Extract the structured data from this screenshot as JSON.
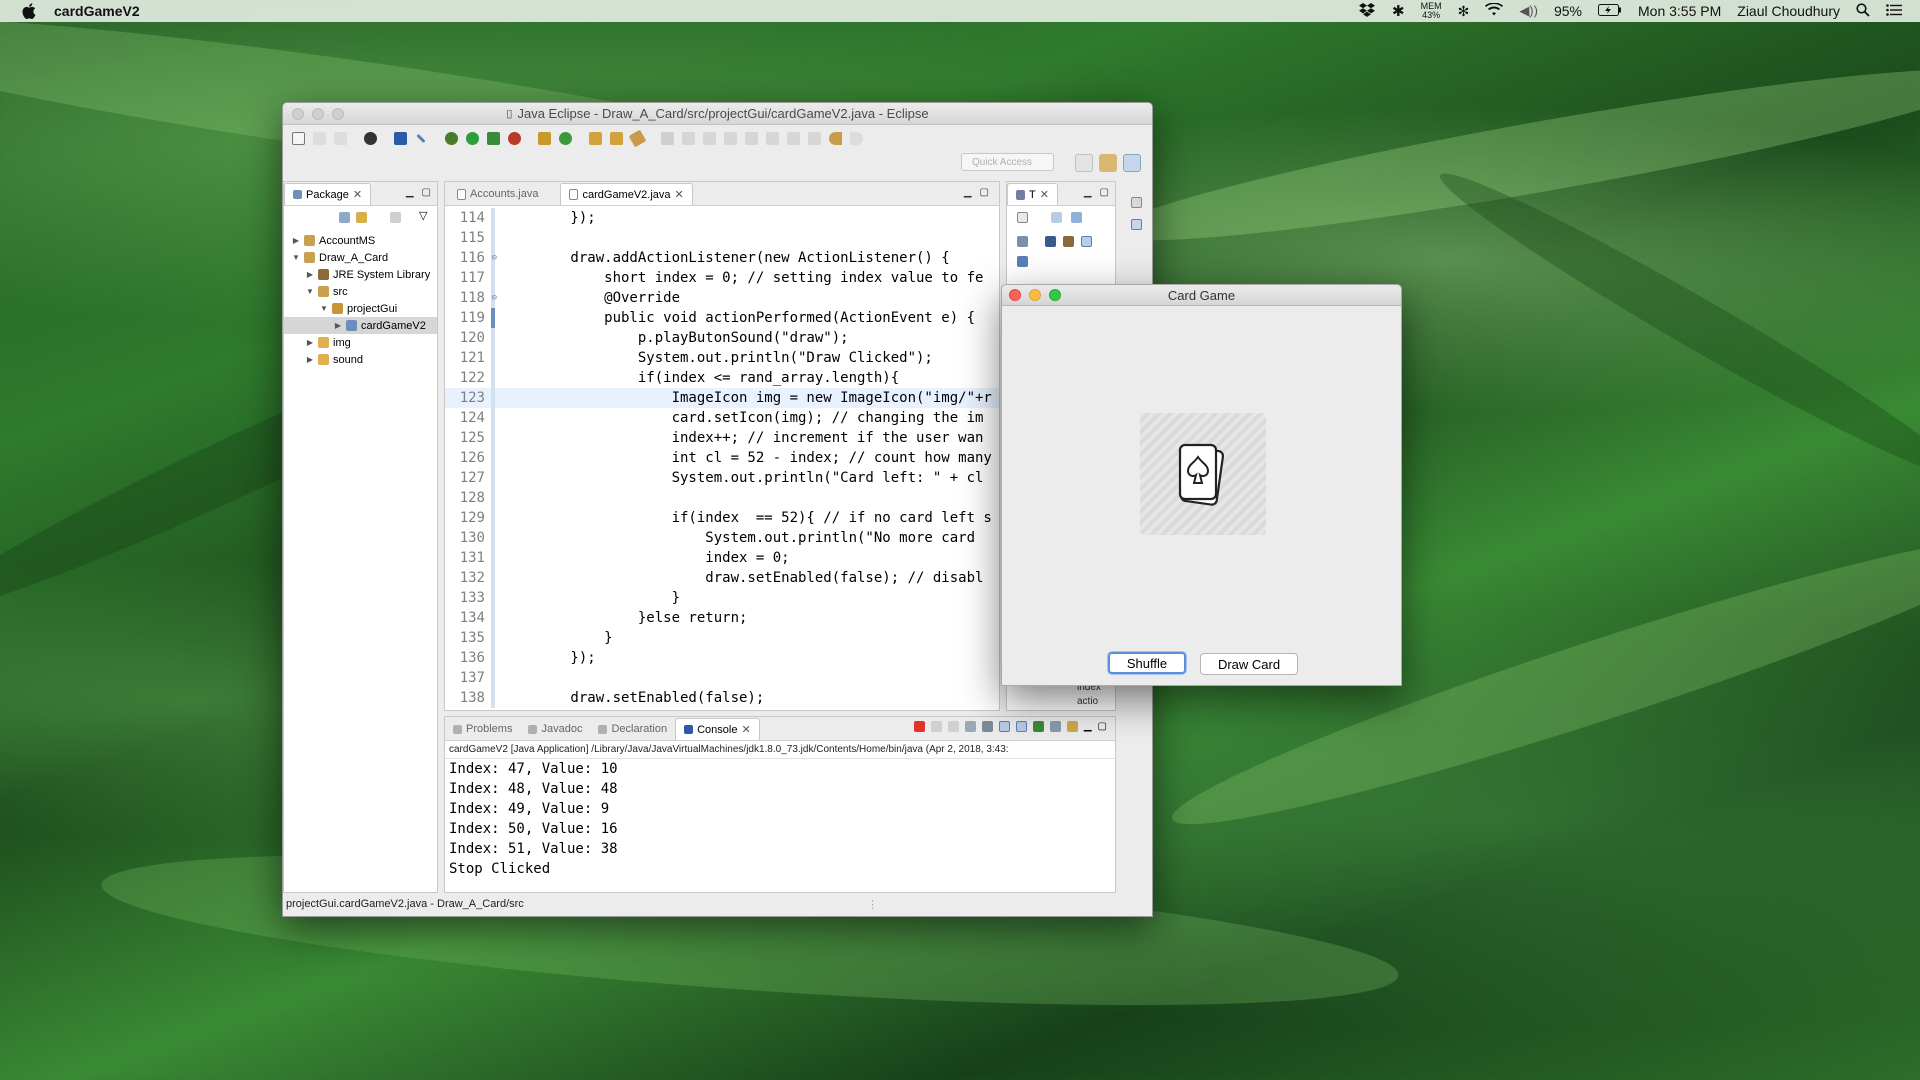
{
  "menubar": {
    "app_name": "cardGameV2",
    "mem_label": "MEM",
    "mem_value": "43%",
    "battery": "95%",
    "clock": "Mon 3:55 PM",
    "user": "Ziaul Choudhury"
  },
  "eclipse": {
    "title": "Java Eclipse - Draw_A_Card/src/projectGui/cardGameV2.java - Eclipse",
    "quick_access_placeholder": "Quick Access",
    "package_explorer": {
      "tab_label": "Package",
      "tree": [
        {
          "label": "AccountMS",
          "level": 0,
          "twisty": "▶",
          "icon": "project-icon"
        },
        {
          "label": "Draw_A_Card",
          "level": 0,
          "twisty": "▼",
          "icon": "project-icon"
        },
        {
          "label": "JRE System Library",
          "level": 1,
          "twisty": "▶",
          "icon": "library-icon"
        },
        {
          "label": "src",
          "level": 1,
          "twisty": "▼",
          "icon": "source-folder-icon"
        },
        {
          "label": "projectGui",
          "level": 2,
          "twisty": "▼",
          "icon": "package-icon"
        },
        {
          "label": "cardGameV2",
          "level": 3,
          "twisty": "▶",
          "icon": "java-file-icon",
          "selected": true
        },
        {
          "label": "img",
          "level": 1,
          "twisty": "▶",
          "icon": "folder-icon"
        },
        {
          "label": "sound",
          "level": 1,
          "twisty": "▶",
          "icon": "folder-icon"
        }
      ]
    },
    "editor": {
      "tabs": [
        {
          "label": "Accounts.java",
          "active": false
        },
        {
          "label": "cardGameV2.java",
          "active": true
        }
      ],
      "lines": [
        {
          "num": "114",
          "text": "        });"
        },
        {
          "num": "115",
          "text": ""
        },
        {
          "num": "116",
          "text": "        draw.addActionListener(new ActionListener() {",
          "fold": true
        },
        {
          "num": "117",
          "text": "            short index = 0; // setting index value to fe"
        },
        {
          "num": "118",
          "text": "            @Override",
          "fold": true
        },
        {
          "num": "119",
          "text": "            public void actionPerformed(ActionEvent e) {",
          "marker": true
        },
        {
          "num": "120",
          "text": "                p.playButonSound(\"draw\");"
        },
        {
          "num": "121",
          "text": "                System.out.println(\"Draw Clicked\");"
        },
        {
          "num": "122",
          "text": "                if(index <= rand_array.length){"
        },
        {
          "num": "123",
          "text": "                    ImageIcon img = new ImageIcon(\"img/\"+r",
          "current": true
        },
        {
          "num": "124",
          "text": "                    card.setIcon(img); // changing the im"
        },
        {
          "num": "125",
          "text": "                    index++; // increment if the user wan"
        },
        {
          "num": "126",
          "text": "                    int cl = 52 - index; // count how many"
        },
        {
          "num": "127",
          "text": "                    System.out.println(\"Card left: \" + cl"
        },
        {
          "num": "128",
          "text": ""
        },
        {
          "num": "129",
          "text": "                    if(index  == 52){ // if no card left s"
        },
        {
          "num": "130",
          "text": "                        System.out.println(\"No more card "
        },
        {
          "num": "131",
          "text": "                        index = 0;"
        },
        {
          "num": "132",
          "text": "                        draw.setEnabled(false); // disabl"
        },
        {
          "num": "133",
          "text": "                    }"
        },
        {
          "num": "134",
          "text": "                }else return;"
        },
        {
          "num": "135",
          "text": "            }"
        },
        {
          "num": "136",
          "text": "        });"
        },
        {
          "num": "137",
          "text": ""
        },
        {
          "num": "138",
          "text": "        draw.setEnabled(false);"
        }
      ]
    },
    "outline": {
      "tab_label": "T",
      "items": [
        "index",
        "actio"
      ]
    },
    "console": {
      "tabs": [
        {
          "label": "Problems",
          "active": false
        },
        {
          "label": "Javadoc",
          "active": false
        },
        {
          "label": "Declaration",
          "active": false
        },
        {
          "label": "Console",
          "active": true
        }
      ],
      "header": "cardGameV2 [Java Application] /Library/Java/JavaVirtualMachines/jdk1.8.0_73.jdk/Contents/Home/bin/java (Apr 2, 2018, 3:43:",
      "lines": [
        "Index: 47, Value: 10",
        "Index: 48, Value: 48",
        "Index: 49, Value: 9",
        "Index: 50, Value: 16",
        "Index: 51, Value: 38",
        "Stop Clicked"
      ]
    },
    "status": "projectGui.cardGameV2.java - Draw_A_Card/src"
  },
  "cardgame": {
    "title": "Card Game",
    "shuffle_label": "Shuffle",
    "draw_label": "Draw Card"
  }
}
